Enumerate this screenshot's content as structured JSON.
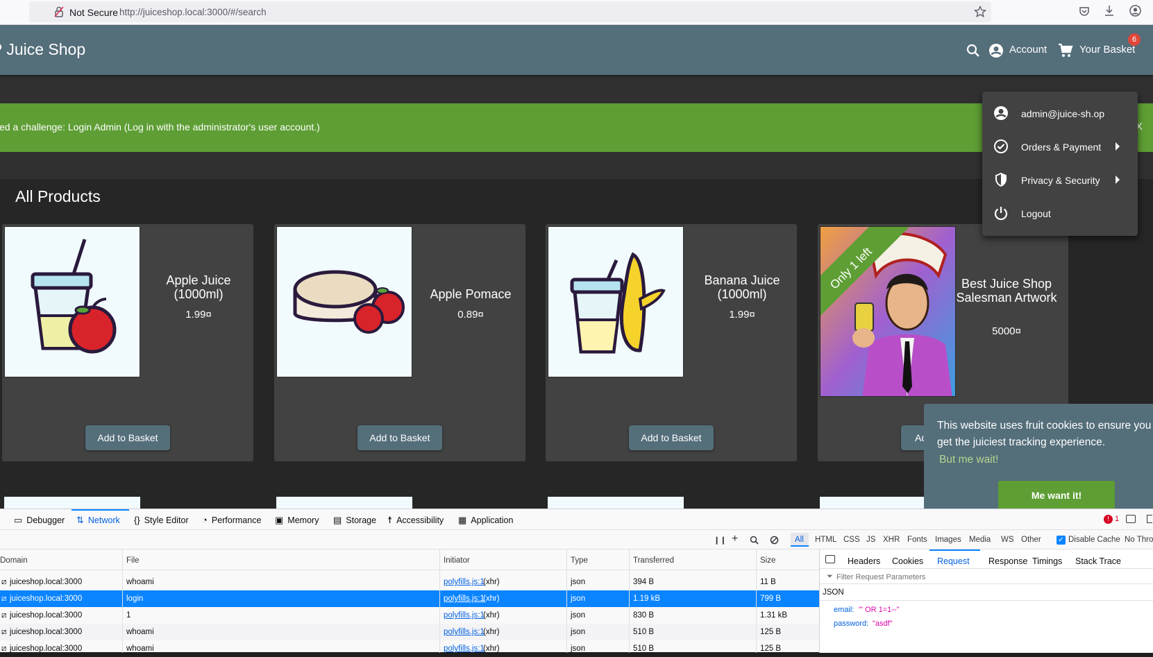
{
  "browser": {
    "security_label": "Not Secure",
    "url": "http://juiceshop.local:3000/#/search"
  },
  "app": {
    "brand": "P Juice Shop",
    "account_label": "Account",
    "basket_label": "Your Basket",
    "basket_count": "6"
  },
  "banner": {
    "text": "ved a challenge: Login Admin (Log in with the administrator's user account.)",
    "close": "X"
  },
  "account_menu": {
    "items": [
      {
        "label": "admin@juice-sh.op",
        "icon": "account-circle-icon"
      },
      {
        "label": "Orders & Payment",
        "icon": "check-circle-icon"
      },
      {
        "label": "Privacy & Security",
        "icon": "shield-icon"
      },
      {
        "label": "Logout",
        "icon": "power-icon"
      }
    ]
  },
  "products": {
    "title": "All Products",
    "add_label": "Add to Basket",
    "ribbon": "Only 1 left",
    "cards": [
      {
        "name": "Apple Juice (1000ml)",
        "price": "1.99¤"
      },
      {
        "name": "Apple Pomace",
        "price": "0.89¤"
      },
      {
        "name": "Banana Juice (1000ml)",
        "price": "1.99¤"
      },
      {
        "name": "Best Juice Shop Salesman Artwork",
        "price": "5000¤"
      }
    ],
    "partial_add_label": "Ad"
  },
  "cookie": {
    "message": "This website uses fruit cookies to ensure you get the juiciest tracking experience.",
    "link": "But me wait!",
    "button": "Me want it!"
  },
  "devtools": {
    "tabs": [
      "Debugger",
      "Network",
      "Style Editor",
      "Performance",
      "Memory",
      "Storage",
      "Accessibility",
      "Application"
    ],
    "active_tab": "Network",
    "error_count": "1",
    "filters": [
      "All",
      "HTML",
      "CSS",
      "JS",
      "XHR",
      "Fonts",
      "Images",
      "Media",
      "WS",
      "Other"
    ],
    "disable_cache": "Disable Cache",
    "throttle": "No Thro",
    "columns": [
      "Domain",
      "File",
      "Initiator",
      "Type",
      "Transferred",
      "Size"
    ],
    "rows": [
      {
        "domain": "juiceshop.local:3000",
        "file": "whoami",
        "initiator": "polyfills.js:1",
        "xhr": "(xhr)",
        "type": "json",
        "transferred": "394 B",
        "size": "11 B"
      },
      {
        "domain": "juiceshop.local:3000",
        "file": "login",
        "initiator": "polyfills.js:1",
        "xhr": "(xhr)",
        "type": "json",
        "transferred": "1.19 kB",
        "size": "799 B"
      },
      {
        "domain": "juiceshop.local:3000",
        "file": "1",
        "initiator": "polyfills.js:1",
        "xhr": "(xhr)",
        "type": "json",
        "transferred": "830 B",
        "size": "1.31 kB"
      },
      {
        "domain": "juiceshop.local:3000",
        "file": "whoami",
        "initiator": "polyfills.js:1",
        "xhr": "(xhr)",
        "type": "json",
        "transferred": "510 B",
        "size": "125 B"
      },
      {
        "domain": "juiceshop.local:3000",
        "file": "whoami",
        "initiator": "polyfills.js:1",
        "xhr": "(xhr)",
        "type": "json",
        "transferred": "510 B",
        "size": "125 B"
      }
    ],
    "side_tabs": [
      "Headers",
      "Cookies",
      "Request",
      "Response",
      "Timings",
      "Stack Trace"
    ],
    "active_side_tab": "Request",
    "filter_params": "Filter Request Parameters",
    "json_label": "JSON",
    "params": [
      {
        "key": "email:",
        "value": "\"' OR 1=1--\""
      },
      {
        "key": "password:",
        "value": "\"asdf\""
      }
    ]
  }
}
